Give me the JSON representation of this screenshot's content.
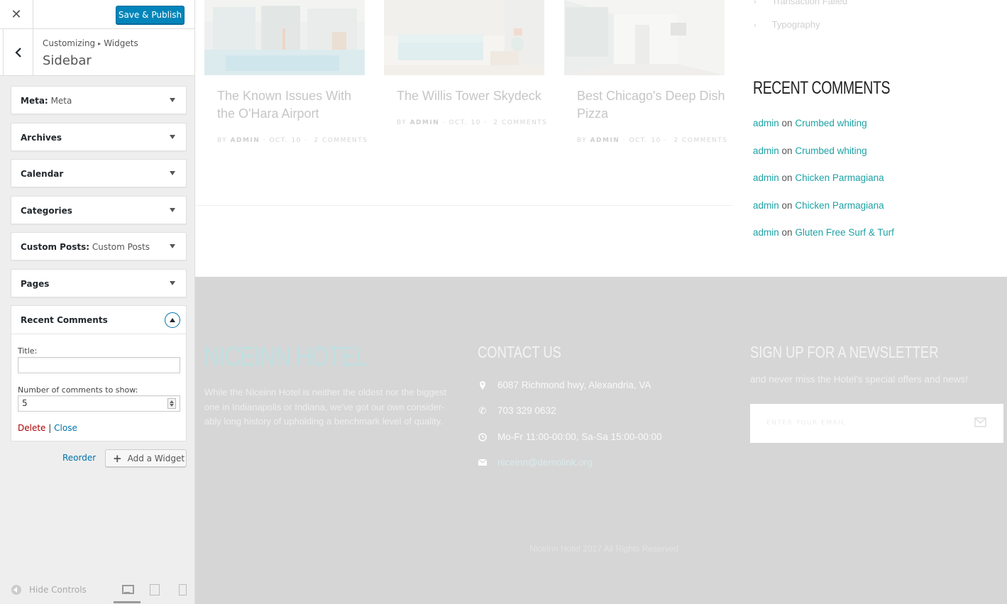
{
  "customizer": {
    "close_symbol": "✕",
    "publish_label": "Save & Publish",
    "breadcrumb": {
      "parent": "Customizing",
      "separator": "▸",
      "current": "Widgets"
    },
    "section_title": "Sidebar",
    "widgets": [
      {
        "name": "Meta",
        "subtitle": "Meta"
      },
      {
        "name": "Archives",
        "subtitle": ""
      },
      {
        "name": "Calendar",
        "subtitle": ""
      },
      {
        "name": "Categories",
        "subtitle": ""
      },
      {
        "name": "Custom Posts",
        "subtitle": "Custom Posts"
      },
      {
        "name": "Pages",
        "subtitle": ""
      }
    ],
    "open_widget": {
      "name": "Recent Comments",
      "title_label": "Title:",
      "title_value": "",
      "count_label": "Number of comments to show:",
      "count_value": "5",
      "delete_label": "Delete",
      "separator": "|",
      "close_label": "Close"
    },
    "reorder_label": "Reorder",
    "add_widget_label": "Add a Widget",
    "add_widget_symbol": "+",
    "hide_controls_label": "Hide Controls",
    "active_device": "desktop"
  },
  "preview": {
    "posts": [
      {
        "title_line1": "The Known Issues With",
        "title_line2": "the O'Hara Airport",
        "by": "BY",
        "author": "ADMIN",
        "date": "OCT. 10",
        "comments": "2 COMMENTS"
      },
      {
        "title_line1": "The Willis Tower Skydeck",
        "title_line2": "",
        "by": "BY",
        "author": "ADMIN",
        "date": "OCT. 10",
        "comments": "2 COMMENTS"
      },
      {
        "title_line1": "Best Chicago's Deep Dish",
        "title_line2": "Pizza",
        "by": "BY",
        "author": "ADMIN",
        "date": "OCT. 10",
        "comments": "2 COMMENTS"
      }
    ],
    "archive_links": [
      "Transaction Failed",
      "Typography"
    ],
    "recent_comments_title": "RECENT COMMENTS",
    "recent_comments": [
      {
        "author": "admin",
        "on": "on",
        "post": "Crumbed whiting"
      },
      {
        "author": "admin",
        "on": "on",
        "post": "Crumbed whiting"
      },
      {
        "author": "admin",
        "on": "on",
        "post": "Chicken Parmagiana"
      },
      {
        "author": "admin",
        "on": "on",
        "post": "Chicken Parmagiana"
      },
      {
        "author": "admin",
        "on": "on",
        "post": "Gluten Free Surf & Turf"
      }
    ],
    "footer": {
      "logo": "NICEINN HOTEL",
      "about": "While the Niceinn Hotel is neither the oldest nor the biggest one in Indianapolis or Indiana, we've got our own consider-ably long history of upholding a benchmark level of quality.",
      "contact_title": "CONTACT US",
      "address": "6087 Richmond hwy, Alexandria, VA",
      "phone": "703 329 0632",
      "hours": "Mo-Fr 11:00-00:00, Sa-Sa 15:00-00:00",
      "email": "niceinn@demolink.org",
      "newsletter_title": "SIGN UP FOR A NEWSLETTER",
      "newsletter_sub": "and never miss the Hotel's special offers and news!",
      "email_placeholder": "ENTER YOUR EMAIL",
      "copyright": "NiceInn Hotel 2017 All Rights Reserved"
    }
  },
  "colors": {
    "accent": "#0085ba",
    "link_teal": "#1ea2a5",
    "delete_red": "#aa0000",
    "footer_bg": "#d6d6d6"
  },
  "icons": [
    "close-icon",
    "back-arrow-icon",
    "dropdown-arrow-icon",
    "collapse-up-icon",
    "spinner-icon",
    "plus-icon",
    "hide-controls-icon",
    "desktop-icon",
    "tablet-icon",
    "mobile-icon",
    "chevron-right-icon",
    "map-pin-icon",
    "phone-icon",
    "clock-icon",
    "envelope-icon",
    "send-icon"
  ]
}
